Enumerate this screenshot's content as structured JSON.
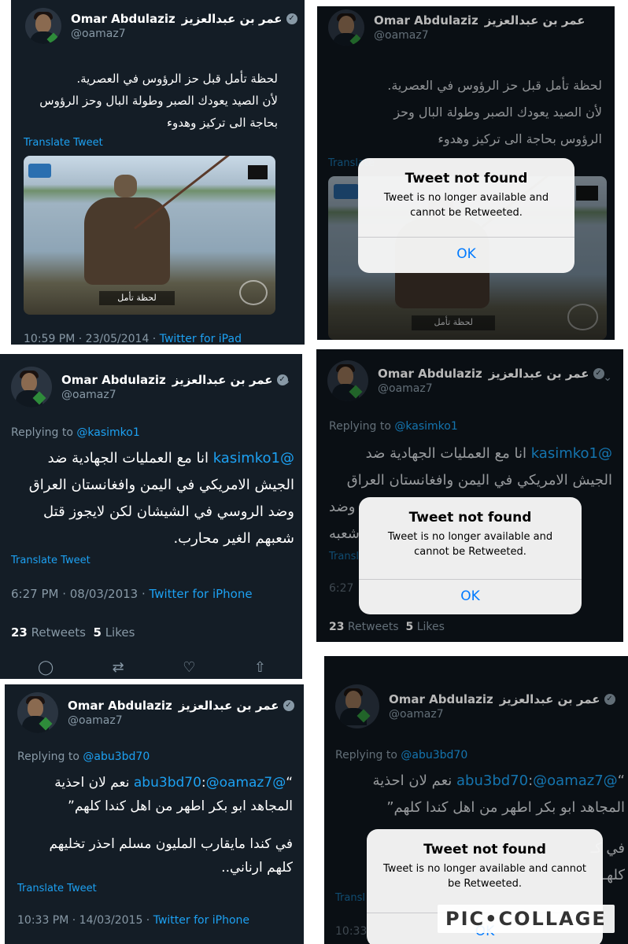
{
  "account": {
    "name": "Omar Abdulaziz",
    "arabic_name": "عمر بن عبدالعزيز",
    "handle": "@oamaz7"
  },
  "tweet1": {
    "text_lines": [
      "لحظة تأمل قبل حز الرؤوس في العصرية.",
      "لأن الصيد يعودك الصبر وطولة البال وحز الرؤوس",
      "بحاجة الى تركيز وهدوء"
    ],
    "translate": "Translate Tweet",
    "image_caption": "لحظة تأمل",
    "time_date": "10:59 PM · 23/05/2014 · ",
    "source": "Twitter for iPad"
  },
  "tweet1_removed": {
    "text_lines": [
      "لحظة تأمل قبل حز الرؤوس في العصرية.",
      "لأن الصيد يعودك الصبر وطولة البال وحز",
      "الرؤوس بحاجة الى تركيز وهدوء"
    ],
    "translate": "Translate"
  },
  "tweet2": {
    "replying_prefix": "Replying to ",
    "replying_to": "@kasimko1",
    "mention": "@kasimko1",
    "text_line1": " انا مع العمليات الجهادية ضد",
    "text_lines": [
      "الجيش الامريكي في اليمن وافغانستان العراق",
      "وضد الروسي في الشيشان لكن لايجوز قتل",
      "شعبهم الغير محارب."
    ],
    "translate": "Translate Tweet",
    "time_date": "6:27 PM · 08/03/2013 · ",
    "source": "Twitter for iPhone",
    "retweets": "23",
    "retweets_label": " Retweets",
    "likes": "5",
    "likes_label": " Likes"
  },
  "tweet2_removed": {
    "text_lines": [
      "الجيش الامريكي في اليمن وافغانستان العراق",
      "وضد",
      "شعبه"
    ],
    "translate": "Transl",
    "time_date": "6:27"
  },
  "tweet3": {
    "replying_prefix": "Replying to ",
    "replying_to": "@abu3bd70",
    "text_line1_pre": "“",
    "mention1": "@abu3bd70",
    "text_colon": ":",
    "mention2": "@oamaz7",
    "text_line1_post": " نعم لان احذية",
    "text_lines": [
      "المجاهد ابو بكر اطهر من اهل كندا كلهم”",
      "في كندا مايقارب المليون مسلم احذر تخليهم",
      "كلهم ارناني.."
    ],
    "translate": "Translate Tweet",
    "time_date": "10:33 PM · 14/03/2015 · ",
    "source": "Twitter for iPhone"
  },
  "tweet3_removed": {
    "text_lines": [
      "المجاهد ابو بكر اطهر من اهل كندا كلهم”",
      "في كـ",
      "كلهـ"
    ],
    "translate": "Transl",
    "time_date": "10:33"
  },
  "alert": {
    "title": "Tweet not found",
    "message": "Tweet is no longer available and cannot be Retweeted.",
    "ok": "OK"
  },
  "watermark": "PIC•COLLAGE"
}
